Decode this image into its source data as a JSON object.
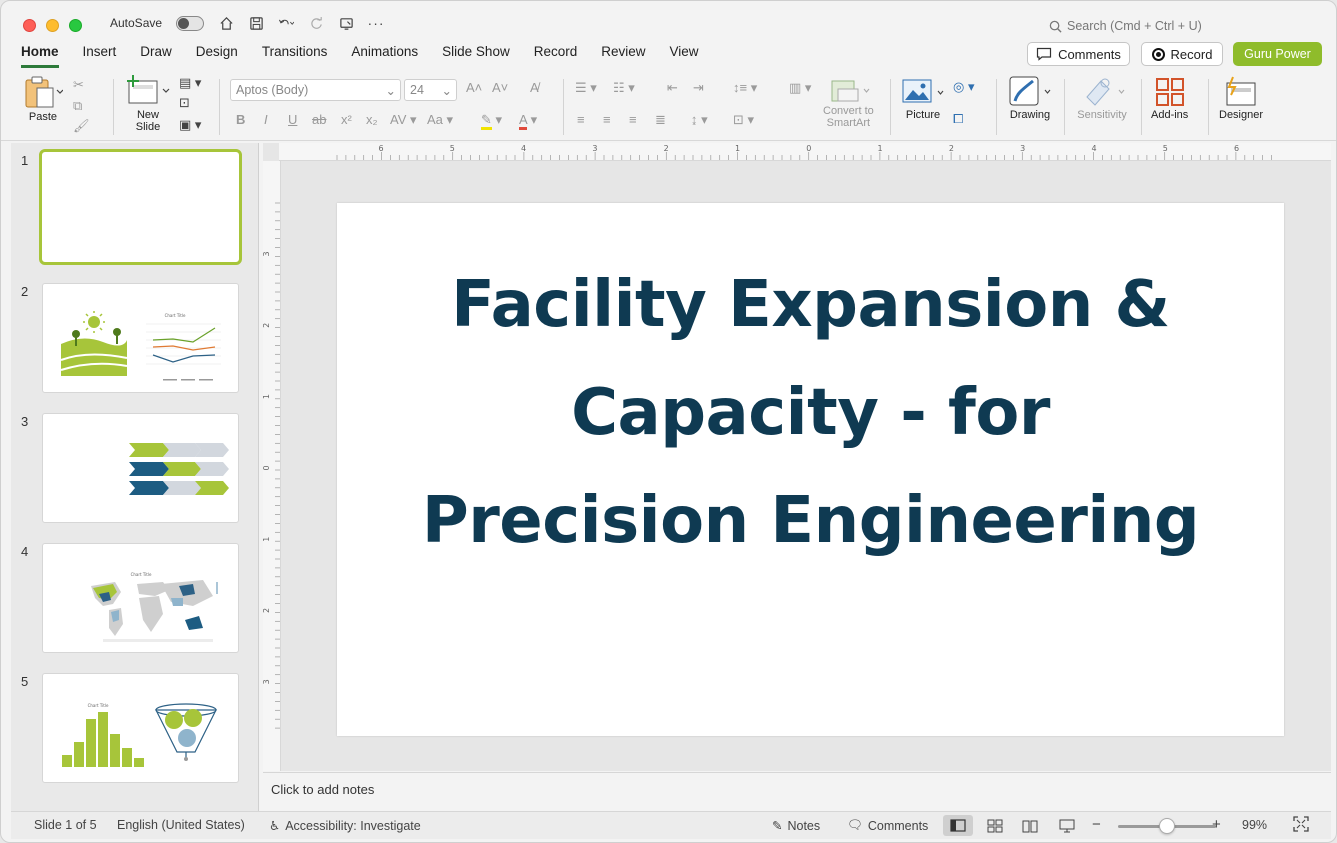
{
  "window": {
    "autosave_label": "AutoSave",
    "search_placeholder": "Search (Cmd + Ctrl + U)"
  },
  "tabs": [
    "Home",
    "Insert",
    "Draw",
    "Design",
    "Transitions",
    "Animations",
    "Slide Show",
    "Record",
    "Review",
    "View"
  ],
  "tab_active": "Home",
  "header_buttons": {
    "comments": "Comments",
    "record": "Record",
    "guru": "Guru Power"
  },
  "ribbon": {
    "paste": "Paste",
    "new_slide_line1": "New",
    "new_slide_line2": "Slide",
    "font_name": "Aptos (Body)",
    "font_size": "24",
    "convert_line1": "Convert to",
    "convert_line2": "SmartArt",
    "picture": "Picture",
    "drawing": "Drawing",
    "sensitivity": "Sensitivity",
    "addins": "Add-ins",
    "designer": "Designer"
  },
  "ruler": {
    "h_ticks": [
      "6",
      "5",
      "4",
      "3",
      "2",
      "1",
      "0",
      "1",
      "2",
      "3",
      "4",
      "5",
      "6"
    ],
    "v_ticks": [
      "3",
      "2",
      "1",
      "0",
      "1",
      "2",
      "3"
    ]
  },
  "slides": [
    {
      "num": "1"
    },
    {
      "num": "2",
      "chart_title": "Chart Title"
    },
    {
      "num": "3"
    },
    {
      "num": "4",
      "chart_title": "Chart Title"
    },
    {
      "num": "5",
      "chart_title": "Chart Title"
    }
  ],
  "current_slide": {
    "title": "Facility Expansion & Capacity - for Precision Engineering"
  },
  "notes_placeholder": "Click to add notes",
  "status": {
    "slide_counter": "Slide 1 of 5",
    "language": "English (United States)",
    "accessibility": "Accessibility: Investigate",
    "notes": "Notes",
    "comments": "Comments",
    "zoom": "99%"
  },
  "colors": {
    "accent_green": "#8fbc2b",
    "title_navy": "#0f3a52",
    "selection_border": "#a7c53a",
    "tab_underline": "#2d7a3a"
  }
}
